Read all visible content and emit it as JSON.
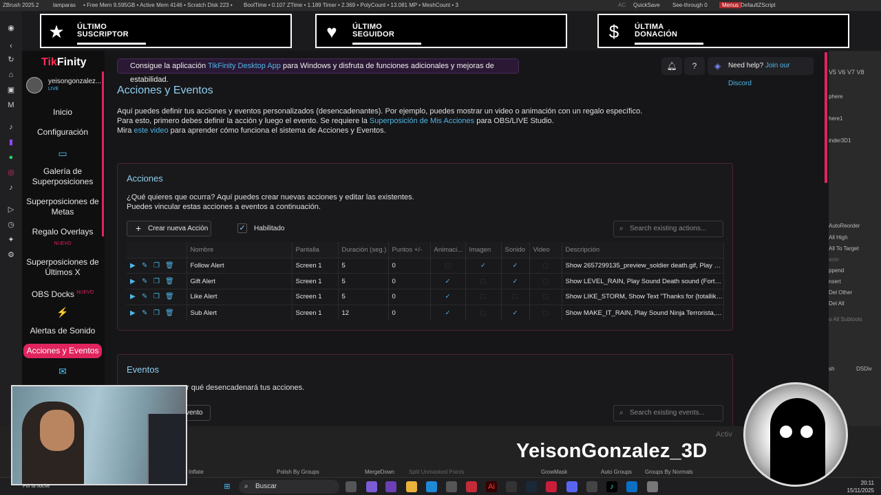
{
  "zbrush_topbar": {
    "items": [
      "ZBrush 2025.2",
      "lamparas",
      "• Free Mem 9.595GB • Active Mem 4146 • Scratch Disk 223 •",
      "BoolTime • 0.107 ZTime • 1.189 Timer • 2.369 • PolyCount • 13.081 MP • MeshCount • 3"
    ],
    "ac": "AC",
    "quicksave": "QuickSave",
    "seethrough": "See-through 0",
    "menus": "Menus",
    "defaultzscript": "DefaultZScript"
  },
  "overlay_widgets": [
    {
      "line1": "ÚLTIMO",
      "line2": "SUSCRIPTOR",
      "icon": "star-icon"
    },
    {
      "line1": "ÚLTIMO",
      "line2": "SEGUIDOR",
      "icon": "heart-icon"
    },
    {
      "line1": "ÚLTIMA",
      "line2": "DONACIÓN",
      "icon": "dollar-icon"
    }
  ],
  "app": {
    "logo_tik": "Tik",
    "logo_finity": "Finity",
    "user": {
      "name": "yeisongonzalez...",
      "status": "LIVE"
    },
    "nav": {
      "inicio": "Inicio",
      "configuracion": "Configuración",
      "galeria": "Galería de Superposiciones",
      "metas": "Superposiciones de Metas",
      "regalo": "Regalo Overlays",
      "regalo_badge": "NUEVO",
      "ultimos": "Superposiciones de Últimos X",
      "obs": "OBS Docks",
      "obs_badge": "NUEVO",
      "alertas": "Alertas de Sonido",
      "acciones": "Acciones y Eventos"
    },
    "promo": {
      "pre": "Consigue la aplicación ",
      "link": "TikFinity Desktop App",
      "post": " para Windows y disfruta de funciones adicionales y mejoras de estabilidad."
    },
    "help": {
      "label": "Need help?",
      "link": "Join our Discord"
    },
    "page_title": "Acciones y Eventos",
    "intro": {
      "line1": "Aquí puedes definir tus acciones y eventos personalizados (desencadenantes). Por ejemplo, puedes mostrar un video o animación con un regalo específico.",
      "line2_pre": "Para esto, primero debes definir la acción y luego el evento. Se requiere la ",
      "line2_link": "Superposición de Mis Acciones",
      "line2_post": " para OBS/LIVE Studio.",
      "line3_pre": "Mira ",
      "line3_link": "este video",
      "line3_post": " para aprender cómo funciona el sistema de Acciones y Eventos."
    },
    "acciones": {
      "title": "Acciones",
      "desc1": "¿Qué quieres que ocurra? Aquí puedes crear nuevas acciones y editar las existentes.",
      "desc2": "Puedes vincular estas acciones a eventos a continuación.",
      "new_button": "Crear nueva Acción",
      "enabled_label": "Habilitado",
      "search_placeholder": "Search existing actions...",
      "columns": [
        "",
        "Nombre",
        "Pantalla",
        "Duración (seg.)",
        "Puntos +/-",
        "Animaci...",
        "Imagen",
        "Sonido",
        "Video",
        "Descripción"
      ],
      "rows": [
        {
          "name": "Follow Alert",
          "screen": "Screen 1",
          "duration": "5",
          "points": "0",
          "anim": false,
          "image": true,
          "sound": true,
          "video": false,
          "desc": "Show 2657299135_preview_soldier death.gif, Play S..."
        },
        {
          "name": "Gift Alert",
          "screen": "Screen 1",
          "duration": "5",
          "points": "0",
          "anim": true,
          "image": false,
          "sound": true,
          "video": false,
          "desc": "Show LEVEL_RAIN, Play Sound Death sound (Fortnit..."
        },
        {
          "name": "Like Alert",
          "screen": "Screen 1",
          "duration": "5",
          "points": "0",
          "anim": true,
          "image": false,
          "sound": false,
          "video": false,
          "desc": "Show LIKE_STORM, Show Text \"Thanks for {totallikec..."
        },
        {
          "name": "Sub Alert",
          "screen": "Screen 1",
          "duration": "12",
          "points": "0",
          "anim": true,
          "image": false,
          "sound": true,
          "video": false,
          "desc": "Show MAKE_IT_RAIN, Play Sound Ninja Terrorista, S..."
        }
      ]
    },
    "eventos": {
      "title": "Eventos",
      "desc": "r qué desencadenará tus acciones.",
      "new_button": "vento",
      "search_placeholder": "Search existing events..."
    }
  },
  "zbrush_right": {
    "tabs": "V5  V6  V7  V8",
    "items": [
      "phere",
      "here1",
      "inder3D1",
      "AutoReorder",
      "All High",
      "All To Target",
      "aste",
      "ppend",
      "nsert",
      "Del Other",
      "Del All",
      "o All Subtools",
      "sh",
      "DSDiv"
    ]
  },
  "zbrush_bottom": [
    "Inflate",
    "Polish By Groups",
    "MergeDown",
    "Split Unmasked Points",
    "GrowMask",
    "Auto Groups",
    "Groups By Normals",
    "Activ"
  ],
  "webcam": {
    "label": "Por la noche"
  },
  "streamer_name": "YeisonGonzalez_3D",
  "taskbar": {
    "search": "Buscar",
    "time": "20:11",
    "date": "15/11/2025"
  }
}
